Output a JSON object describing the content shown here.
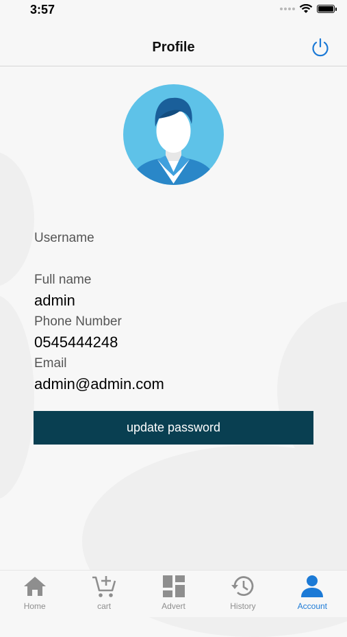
{
  "status_bar": {
    "time": "3:57"
  },
  "nav": {
    "title": "Profile"
  },
  "profile": {
    "username_label": "Username",
    "username_value": "",
    "fullname_label": "Full name",
    "fullname_value": "admin",
    "phone_label": "Phone Number",
    "phone_value": "0545444248",
    "email_label": "Email",
    "email_value": "admin@admin.com"
  },
  "update_button": {
    "label": "update password"
  },
  "tabs": [
    {
      "label": "Home",
      "icon": "home-icon",
      "active": false
    },
    {
      "label": "cart",
      "icon": "cart-add-icon",
      "active": false
    },
    {
      "label": "Advert",
      "icon": "dashboard-icon",
      "active": false
    },
    {
      "label": "History",
      "icon": "history-icon",
      "active": false
    },
    {
      "label": "Account",
      "icon": "person-icon",
      "active": true
    }
  ],
  "colors": {
    "accent": "#1c7ad6",
    "button_bg": "#093f51",
    "avatar_bg": "#5ec2e8",
    "inactive_icon": "#8e8e8e"
  }
}
